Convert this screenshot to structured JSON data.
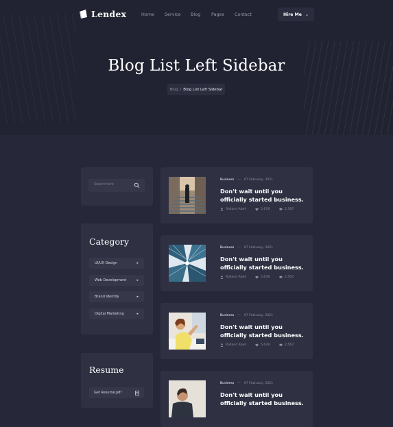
{
  "header": {
    "logo_text": "Lendex",
    "nav": [
      "Home",
      "Service",
      "Blog",
      "Pages",
      "Contact"
    ],
    "hire_button": "Hire Me"
  },
  "hero": {
    "title": "Blog List Left Sidebar",
    "breadcrumb": [
      "Blog",
      "Blog List Left Sidebar"
    ],
    "breadcrumb_sep": "/"
  },
  "sidebar": {
    "search_placeholder": "Search here",
    "category_title": "Category",
    "categories": [
      "UI/UX Design",
      "Web Development",
      "Brand Identity",
      "Digital Marketing"
    ],
    "resume_title": "Resume",
    "resume_item": "Get Resume.pdf"
  },
  "posts": [
    {
      "category": "Business",
      "date": "07 February, 2021",
      "title": "Don't wait until you officially started business.",
      "author": "Rolland Abell",
      "likes": "5,678",
      "comments": "2,567"
    },
    {
      "category": "Business",
      "date": "07 February, 2021",
      "title": "Don't wait until you officially started business.",
      "author": "Rolland Abell",
      "likes": "5,678",
      "comments": "2,567"
    },
    {
      "category": "Business",
      "date": "07 February, 2021",
      "title": "Don't wait until you officially started business.",
      "author": "Rolland Abell",
      "likes": "5,678",
      "comments": "2,567"
    },
    {
      "category": "Business",
      "date": "07 February, 2021",
      "title": "Don't wait until you officially started business."
    }
  ],
  "colors": {
    "background": "#262839",
    "hero": "#212332",
    "card": "#2f3143",
    "field": "#363849"
  }
}
